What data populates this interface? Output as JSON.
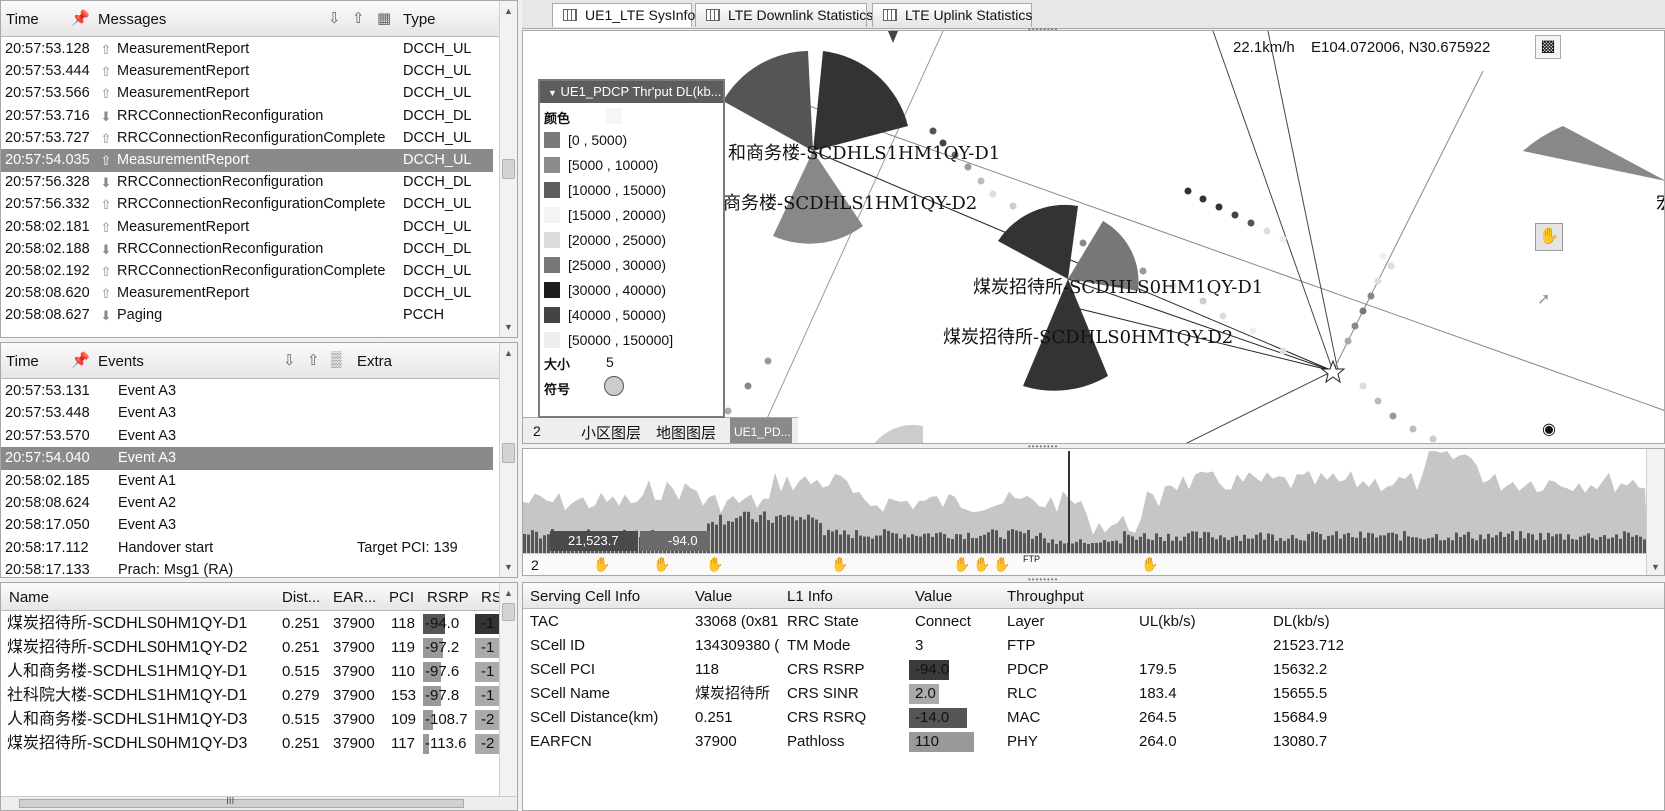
{
  "messages": {
    "headers": {
      "time": "Time",
      "messages": "Messages",
      "type": "Type"
    },
    "rows": [
      {
        "time": "20:57:53.128",
        "dir": "up",
        "msg": "MeasurementReport",
        "type": "DCCH_UL"
      },
      {
        "time": "20:57:53.444",
        "dir": "up",
        "msg": "MeasurementReport",
        "type": "DCCH_UL"
      },
      {
        "time": "20:57:53.566",
        "dir": "up",
        "msg": "MeasurementReport",
        "type": "DCCH_UL"
      },
      {
        "time": "20:57:53.716",
        "dir": "down",
        "msg": "RRCConnectionReconfiguration",
        "type": "DCCH_DL"
      },
      {
        "time": "20:57:53.727",
        "dir": "up",
        "msg": "RRCConnectionReconfigurationComplete",
        "type": "DCCH_UL"
      },
      {
        "time": "20:57:54.035",
        "dir": "up",
        "msg": "MeasurementReport",
        "type": "DCCH_UL",
        "selected": true
      },
      {
        "time": "20:57:56.328",
        "dir": "down",
        "msg": "RRCConnectionReconfiguration",
        "type": "DCCH_DL"
      },
      {
        "time": "20:57:56.332",
        "dir": "up",
        "msg": "RRCConnectionReconfigurationComplete",
        "type": "DCCH_UL"
      },
      {
        "time": "20:58:02.181",
        "dir": "up",
        "msg": "MeasurementReport",
        "type": "DCCH_UL"
      },
      {
        "time": "20:58:02.188",
        "dir": "down",
        "msg": "RRCConnectionReconfiguration",
        "type": "DCCH_DL"
      },
      {
        "time": "20:58:02.192",
        "dir": "up",
        "msg": "RRCConnectionReconfigurationComplete",
        "type": "DCCH_UL"
      },
      {
        "time": "20:58:08.620",
        "dir": "up",
        "msg": "MeasurementReport",
        "type": "DCCH_UL"
      },
      {
        "time": "20:58:08.627",
        "dir": "down",
        "msg": "Paging",
        "type": "PCCH"
      }
    ]
  },
  "events": {
    "headers": {
      "time": "Time",
      "events": "Events",
      "extra": "Extra"
    },
    "rows": [
      {
        "time": "20:57:53.131",
        "event": "Event A3",
        "extra": ""
      },
      {
        "time": "20:57:53.448",
        "event": "Event A3",
        "extra": ""
      },
      {
        "time": "20:57:53.570",
        "event": "Event A3",
        "extra": ""
      },
      {
        "time": "20:57:54.040",
        "event": "Event A3",
        "extra": "",
        "selected": true
      },
      {
        "time": "20:58:02.185",
        "event": "Event A1",
        "extra": ""
      },
      {
        "time": "20:58:08.624",
        "event": "Event A2",
        "extra": ""
      },
      {
        "time": "20:58:17.050",
        "event": "Event A3",
        "extra": ""
      },
      {
        "time": "20:58:17.112",
        "event": "Handover start",
        "extra": "Target PCI: 139"
      },
      {
        "time": "20:58:17.133",
        "event": "Prach: Msg1 (RA)",
        "extra": ""
      }
    ]
  },
  "neighbors": {
    "headers": {
      "name": "Name",
      "dist": "Dist...",
      "earfcn": "EAR...",
      "pci": "PCI",
      "rsrp": "RSRP",
      "rs": "RS"
    },
    "rows": [
      {
        "name": "煤炭招待所-SCDHLS0HM1QY-D1",
        "dist": "0.251",
        "earfcn": "37900",
        "pci": "118",
        "rsrp": "-94.0",
        "rs": "-1"
      },
      {
        "name": "煤炭招待所-SCDHLS0HM1QY-D2",
        "dist": "0.251",
        "earfcn": "37900",
        "pci": "119",
        "rsrp": "-97.2",
        "rs": "-1"
      },
      {
        "name": "人和商务楼-SCDHLS1HM1QY-D1",
        "dist": "0.515",
        "earfcn": "37900",
        "pci": "110",
        "rsrp": "-97.6",
        "rs": "-1"
      },
      {
        "name": "社科院大楼-SCDHLS1HM1QY-D1",
        "dist": "0.279",
        "earfcn": "37900",
        "pci": "153",
        "rsrp": "-97.8",
        "rs": "-1"
      },
      {
        "name": "人和商务楼-SCDHLS1HM1QY-D3",
        "dist": "0.515",
        "earfcn": "37900",
        "pci": "109",
        "rsrp": "-108.7",
        "rs": "-2"
      },
      {
        "name": "煤炭招待所-SCDHLS0HM1QY-D3",
        "dist": "0.251",
        "earfcn": "37900",
        "pci": "117",
        "rsrp": "-113.6",
        "rs": "-2"
      }
    ],
    "scroll_label": "III"
  },
  "tabs": [
    {
      "label": "UE1_LTE SysInfo",
      "active": true
    },
    {
      "label": "LTE Downlink Statistics",
      "active": false
    },
    {
      "label": "LTE Uplink Statistics",
      "active": false
    }
  ],
  "map": {
    "speed": "22.1km/h",
    "coords": "E104.072006, N30.675922",
    "labels": [
      "和商务楼-SCDHLS1HM1QY-D1",
      "商务楼-SCDHLS1HM1QY-D2",
      "煤炭招待所-SCDHLS0HM1QY-D1",
      "煤炭招待所-SCDHLS0HM1QY-D2",
      "宏"
    ],
    "bottom_tabs": {
      "num": "2",
      "cell_layer": "小区图层",
      "map_layer": "地图图层",
      "pd": "UE1_PD..."
    }
  },
  "legend": {
    "title": "UE1_PDCP Thr'put DL(kb...",
    "color_label": "颜色",
    "items": [
      {
        "label": "[0 , 5000)",
        "color": "#7a7a7a"
      },
      {
        "label": "[5000 , 10000)",
        "color": "#8c8c8c"
      },
      {
        "label": "[10000 , 15000)",
        "color": "#5e5e5e"
      },
      {
        "label": "[15000 , 20000)",
        "color": "#f4f4f4"
      },
      {
        "label": "[20000 , 25000)",
        "color": "#dcdcdc"
      },
      {
        "label": "[25000 , 30000)",
        "color": "#777777"
      },
      {
        "label": "[30000 , 40000)",
        "color": "#1c1c1c"
      },
      {
        "label": "[40000 , 50000)",
        "color": "#444444"
      },
      {
        "label": "[50000 , 150000]",
        "color": "#ededed"
      }
    ],
    "size_label": "大小",
    "size_value": "5",
    "symbol_label": "符号"
  },
  "timeline": {
    "num": "2",
    "value1": "21,523.7",
    "value2": "-94.0",
    "ftp": "FTP"
  },
  "serving": {
    "headers": {
      "info": "Serving Cell Info",
      "value": "Value",
      "l1": "L1 Info",
      "l1value": "Value",
      "tp": "Throughput"
    },
    "rows": [
      {
        "info": "TAC",
        "value": "33068 (0x81",
        "l1": "RRC State",
        "l1value": "Connect",
        "tp": "Layer",
        "ul": "UL(kb/s)",
        "dl": "DL(kb/s)"
      },
      {
        "info": "SCell ID",
        "value": "134309380 (",
        "l1": "TM Mode",
        "l1value": "3",
        "tp": "FTP",
        "ul": "",
        "dl": "21523.712"
      },
      {
        "info": "SCell PCI",
        "value": "118",
        "l1": "CRS RSRP",
        "l1value": "-94.0",
        "tp": "PDCP",
        "ul": "179.5",
        "dl": "15632.2"
      },
      {
        "info": "SCell Name",
        "value": "煤炭招待所",
        "l1": "CRS SINR",
        "l1value": "2.0",
        "tp": "RLC",
        "ul": "183.4",
        "dl": "15655.5"
      },
      {
        "info": "SCell Distance(km)",
        "value": "0.251",
        "l1": "CRS RSRQ",
        "l1value": "-14.0",
        "tp": "MAC",
        "ul": "264.5",
        "dl": "15684.9"
      },
      {
        "info": "EARFCN",
        "value": "37900",
        "l1": "Pathloss",
        "l1value": "110",
        "tp": "PHY",
        "ul": "264.0",
        "dl": "13080.7"
      }
    ]
  }
}
